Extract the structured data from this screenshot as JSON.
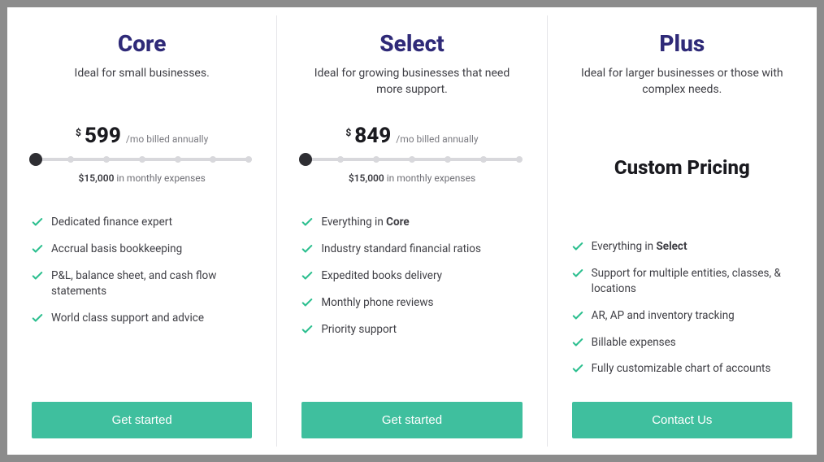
{
  "plans": [
    {
      "title": "Core",
      "desc": "Ideal for small businesses.",
      "currency": "$",
      "amount": "599",
      "suffix": "/mo billed annually",
      "slider_label_amount": "$15,000",
      "slider_label_rest": " in monthly expenses",
      "features": [
        {
          "html": "Dedicated finance expert"
        },
        {
          "html": "Accrual basis bookkeeping"
        },
        {
          "html": "P&L, balance sheet, and cash flow statements"
        },
        {
          "html": "World class support and advice"
        }
      ],
      "cta": "Get started"
    },
    {
      "title": "Select",
      "desc": "Ideal for growing businesses that need more support.",
      "currency": "$",
      "amount": "849",
      "suffix": "/mo billed annually",
      "slider_label_amount": "$15,000",
      "slider_label_rest": " in monthly expenses",
      "features": [
        {
          "html": "Everything in <b>Core</b>"
        },
        {
          "html": "Industry standard financial ratios"
        },
        {
          "html": "Expedited books delivery"
        },
        {
          "html": "Monthly phone reviews"
        },
        {
          "html": "Priority support"
        }
      ],
      "cta": "Get started"
    },
    {
      "title": "Plus",
      "desc": "Ideal for larger businesses or those with complex needs.",
      "custom_pricing": "Custom Pricing",
      "features": [
        {
          "html": "Everything in <b>Select</b>"
        },
        {
          "html": "Support for multiple entities, classes, & locations"
        },
        {
          "html": "AR, AP and inventory tracking"
        },
        {
          "html": "Billable expenses"
        },
        {
          "html": "Fully customizable chart of accounts"
        }
      ],
      "cta": "Contact Us"
    }
  ]
}
